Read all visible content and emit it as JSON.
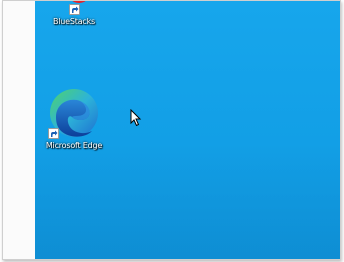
{
  "desktop": {
    "icons": [
      {
        "label": "BlueStacks",
        "icon": "bluestacks-icon"
      },
      {
        "label": "Microsoft Edge",
        "icon": "edge-icon"
      }
    ]
  }
}
